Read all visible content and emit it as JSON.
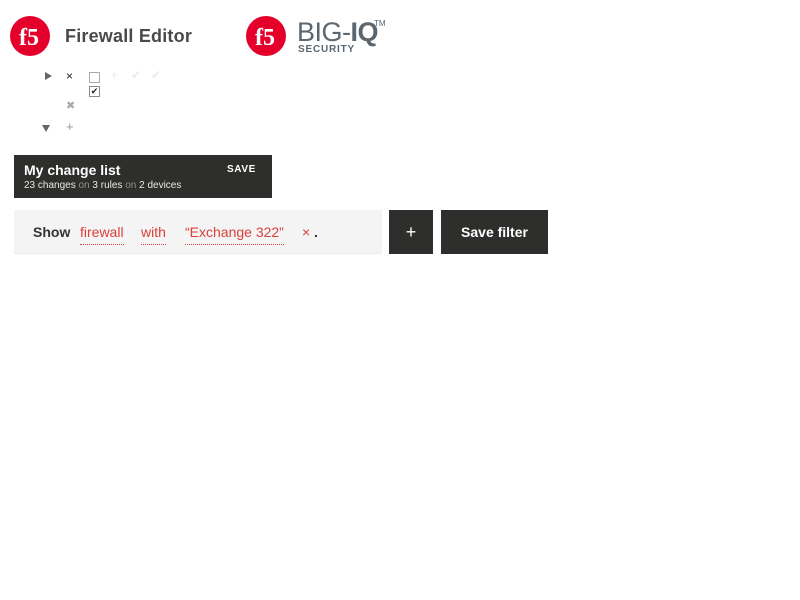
{
  "header": {
    "brand_logo_text": "f5",
    "app_title": "Firewall Editor",
    "product": {
      "logo_text": "f5",
      "name_light": "BIG-",
      "name_bold": "IQ",
      "trademark": "TM",
      "subtitle": "SECURITY"
    }
  },
  "tree": {
    "row1": {
      "expander": "triangle-right-icon",
      "close_glyph": "×"
    },
    "row2": {
      "checkbox_checked": true,
      "check_glyph": "✔"
    },
    "row3": {
      "close_glyph": "✖"
    },
    "row4": {
      "expander": "triangle-down-icon",
      "add_glyph": "+"
    }
  },
  "change_list": {
    "title": "My change list",
    "save_label": "SAVE",
    "changes_count": "23 changes",
    "on1": "on",
    "rules_count": "3 rules",
    "on2": "on",
    "devices_count": "2 devices"
  },
  "filter": {
    "show_label": "Show",
    "tokens": [
      "firewall",
      "with",
      "“Exchange 322”"
    ],
    "remove_glyph": "×",
    "period": "."
  },
  "actions": {
    "add_label": "+",
    "save_filter_label": "Save filter"
  },
  "colors": {
    "brand_red": "#e4002b",
    "token_red": "#d9403b",
    "dark_panel": "#2e2e2c",
    "filter_bg": "#f4f4f4"
  }
}
